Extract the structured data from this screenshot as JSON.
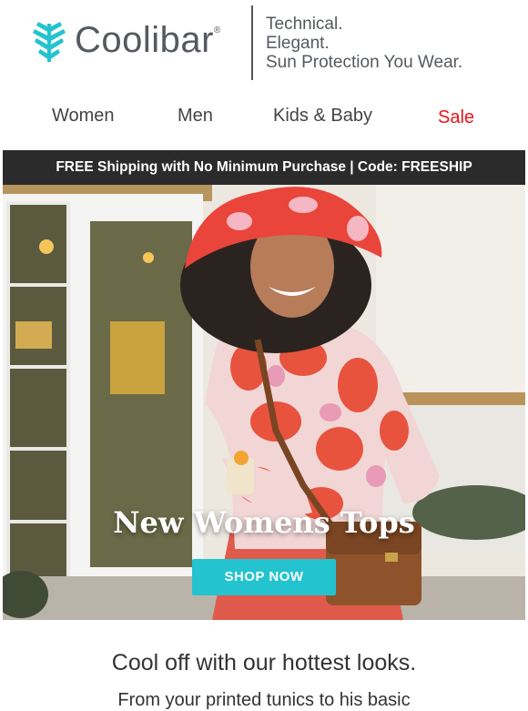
{
  "brand": {
    "name": "Coolibar",
    "registered": "®",
    "tagline": [
      "Technical.",
      "Elegant.",
      "Sun Protection You Wear."
    ],
    "logo_color": "#23c3cf"
  },
  "nav": {
    "items": [
      {
        "label": "Women"
      },
      {
        "label": "Men"
      },
      {
        "label": "Kids & Baby"
      },
      {
        "label": "Sale"
      }
    ]
  },
  "promo": {
    "text": "FREE Shipping with No Minimum Purchase | Code: FREESHIP"
  },
  "hero": {
    "title": "New Womens Tops",
    "button_label": "SHOP NOW",
    "button_color": "#23c3cf"
  },
  "body": {
    "headline": "Cool off with our hottest looks.",
    "subline": "From your printed tunics to his basic"
  }
}
